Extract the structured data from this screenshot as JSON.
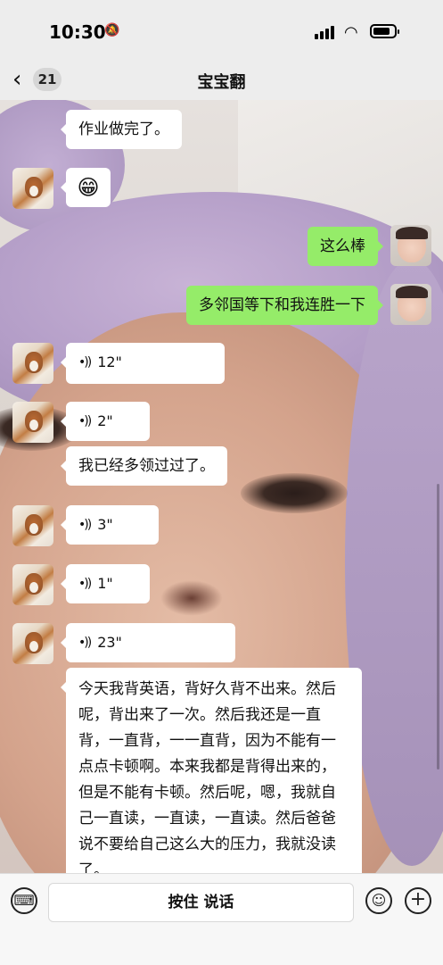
{
  "status_bar": {
    "time": "10:30"
  },
  "nav": {
    "unread_count": "21",
    "title": "宝宝翻"
  },
  "messages": [
    {
      "side": "left",
      "type": "text",
      "text": "作业做完了。"
    },
    {
      "side": "left",
      "type": "emoji",
      "text": "😁"
    },
    {
      "side": "right",
      "type": "text",
      "text": "这么棒"
    },
    {
      "side": "right",
      "type": "text",
      "text": "多邻国等下和我连胜一下"
    },
    {
      "side": "left",
      "type": "voice",
      "duration": "12\""
    },
    {
      "side": "left",
      "type": "voice",
      "duration": "2\""
    },
    {
      "side": "left",
      "type": "text",
      "text": "我已经多领过过了。"
    },
    {
      "side": "left",
      "type": "voice",
      "duration": "3\""
    },
    {
      "side": "left",
      "type": "voice",
      "duration": "1\""
    },
    {
      "side": "left",
      "type": "voice",
      "duration": "23\""
    },
    {
      "side": "left",
      "type": "text",
      "text": "今天我背英语，背好久背不出来。然后呢，背出来了一次。然后我还是一直背，一直背，一一直背，因为不能有一点点卡顿啊。本来我都是背得出来的，但是不能有卡顿。然后呢，嗯，我就自己一直读，一直读，一直读。然后爸爸说不要给自己这么大的压力，我就没读了。"
    }
  ],
  "input_bar": {
    "hold_to_talk": "按住 说话"
  }
}
